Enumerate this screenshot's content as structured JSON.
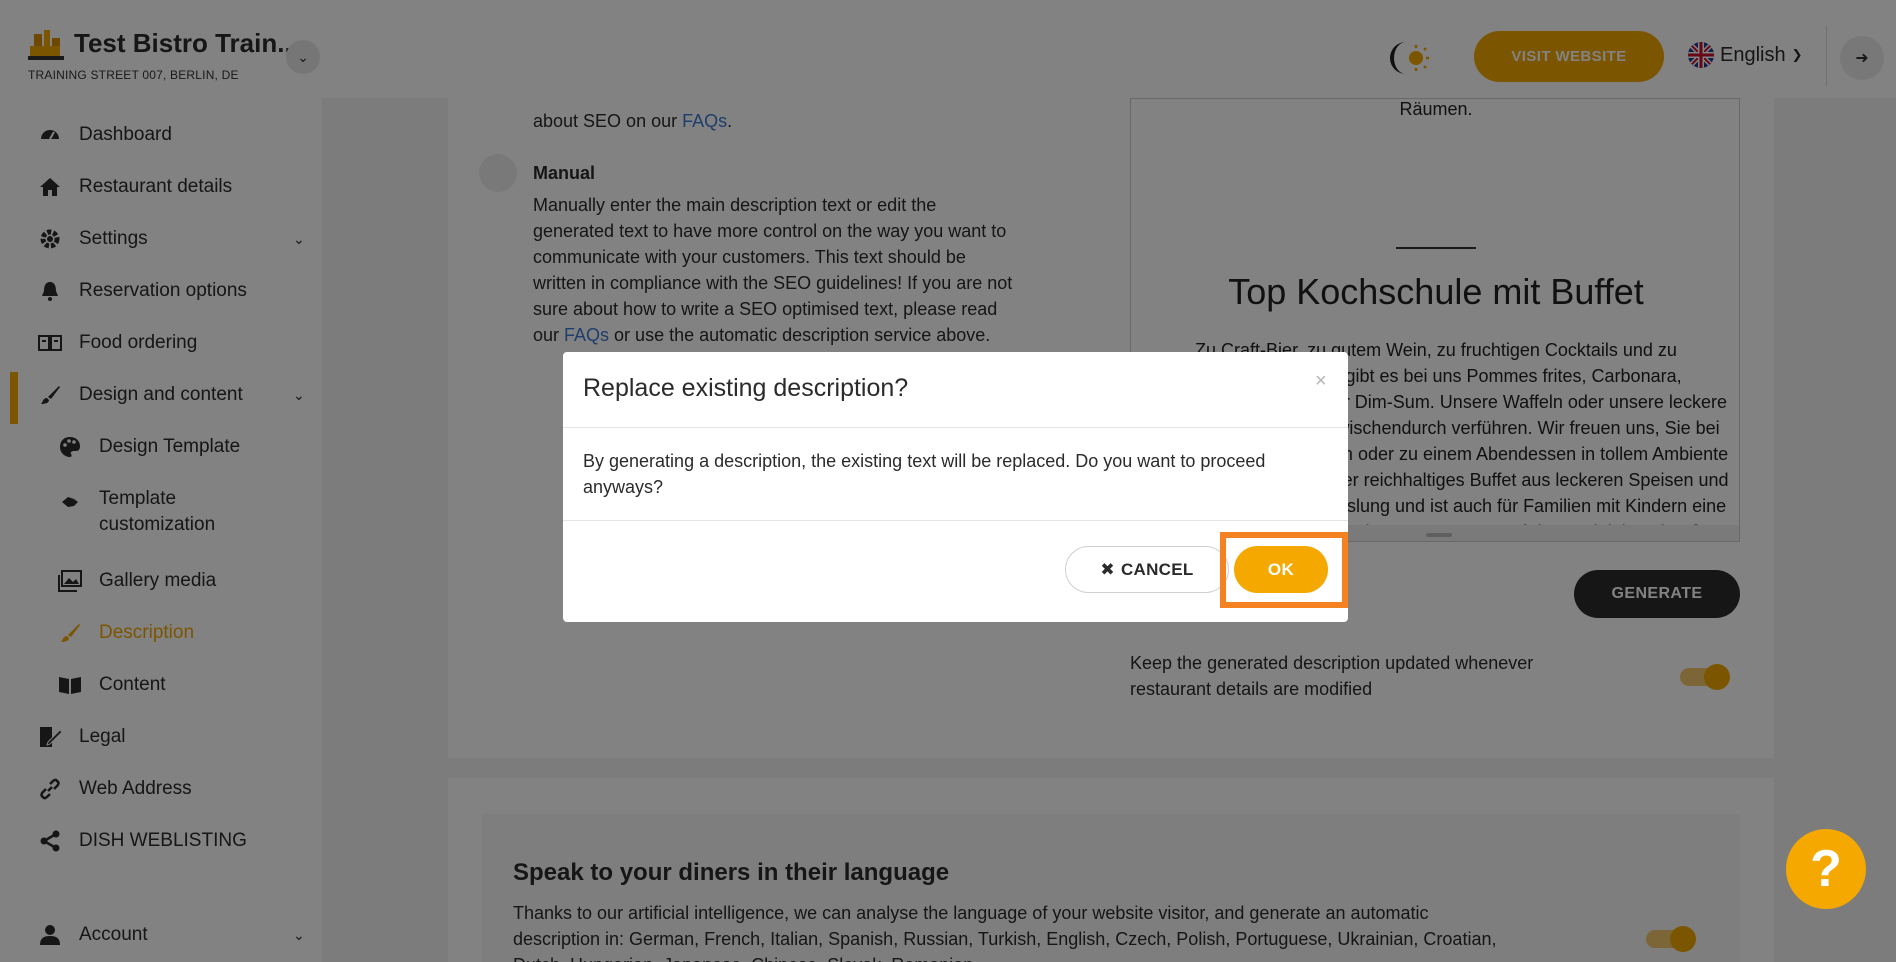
{
  "header": {
    "brand_title": "Test Bistro Train...",
    "brand_address": "TRAINING STREET 007, BERLIN, DE",
    "visit_website": "VISIT WEBSITE",
    "language": "English",
    "accent_color": "#f4a800"
  },
  "sidebar": {
    "items": [
      {
        "label": "Dashboard",
        "icon": "dashboard-icon"
      },
      {
        "label": "Restaurant details",
        "icon": "home-icon"
      },
      {
        "label": "Settings",
        "icon": "gear-icon"
      },
      {
        "label": "Reservation options",
        "icon": "bell-icon"
      },
      {
        "label": "Food ordering",
        "icon": "food-icon"
      },
      {
        "label": "Design and content",
        "icon": "brush-icon"
      },
      {
        "label": "Design Template",
        "icon": "palette-icon"
      },
      {
        "label": "Template customization",
        "icon": "template-icon"
      },
      {
        "label": "Gallery media",
        "icon": "image-icon"
      },
      {
        "label": "Description",
        "icon": "brush-icon"
      },
      {
        "label": "Content",
        "icon": "book-icon"
      },
      {
        "label": "Legal",
        "icon": "legal-icon"
      },
      {
        "label": "Web Address",
        "icon": "link-icon"
      },
      {
        "label": "DISH WEBLISTING",
        "icon": "share-icon"
      },
      {
        "label": "Account",
        "icon": "user-icon"
      }
    ]
  },
  "main": {
    "seo_line_prefix": "about SEO on our ",
    "faqs_link": "FAQs",
    "seo_line_suffix": ".",
    "manual_title": "Manual",
    "manual_text_lines": [
      "Manually enter the main description text or edit the",
      "generated text to have more control on the way you want to",
      "communicate with your customers. This text should be",
      "written in compliance with the SEO guidelines! If you are not",
      "sure about how to write a SEO optimised text, please read"
    ],
    "manual_last_prefix": "our ",
    "manual_last_link": "FAQs",
    "manual_last_suffix": " or use the automatic description service above.",
    "preview_top_text": "Räumen.",
    "preview_title": "Top Kochschule mit Buffet",
    "preview_body": "Zu Craft-Bier, zu gutem Wein, zu fruchtigen Cocktails und zu aromatischem Bier gibt es bei uns Pommes frites, Carbonara, Ofenkartoffeln, Käse oder Dim-Sum. Unsere Waffeln oder unsere leckere Eiscreme werden Sie zwischendurch verführen. Wir freuen uns, Sie bei uns zu einem Mittagessen oder zu einem Abendessen in tollem Ambiente begrüßen zu dürfen! Unser reichhaltiges Buffet aus leckeren Speisen und Getränken bietet Abwechslung und ist auch für Familien mit Kindern eine schöne Gelegenheit, gemeinsam zu essen. Auf dem Spielplatz draußen können Ihre Kinder eine fantastische Zeit verbringen. Der Raucherbereich bietet",
    "generate_label": "GENERATE",
    "keep_updated_lines": [
      "Keep the generated description updated whenever",
      "restaurant details are modified"
    ],
    "speak_title": "Speak to your diners in their language",
    "speak_text_lines": [
      "Thanks to our artificial intelligence, we can analyse the language of your website visitor, and generate an automatic",
      "description in: German, French, Italian, Spanish, Russian, Turkish, English, Czech, Polish, Portuguese, Ukrainian, Croatian,",
      "Dutch, Hungarian, Japanese, Chinese, Slovak, Romanian"
    ]
  },
  "modal": {
    "title": "Replace existing description?",
    "close_glyph": "×",
    "body": "By generating a description, the existing text will be replaced. Do you want to proceed anyways?",
    "cancel_glyph": "✖",
    "cancel_label": "CANCEL",
    "ok_label": "OK",
    "highlight_color": "#f58220"
  },
  "help": {
    "glyph": "?"
  }
}
